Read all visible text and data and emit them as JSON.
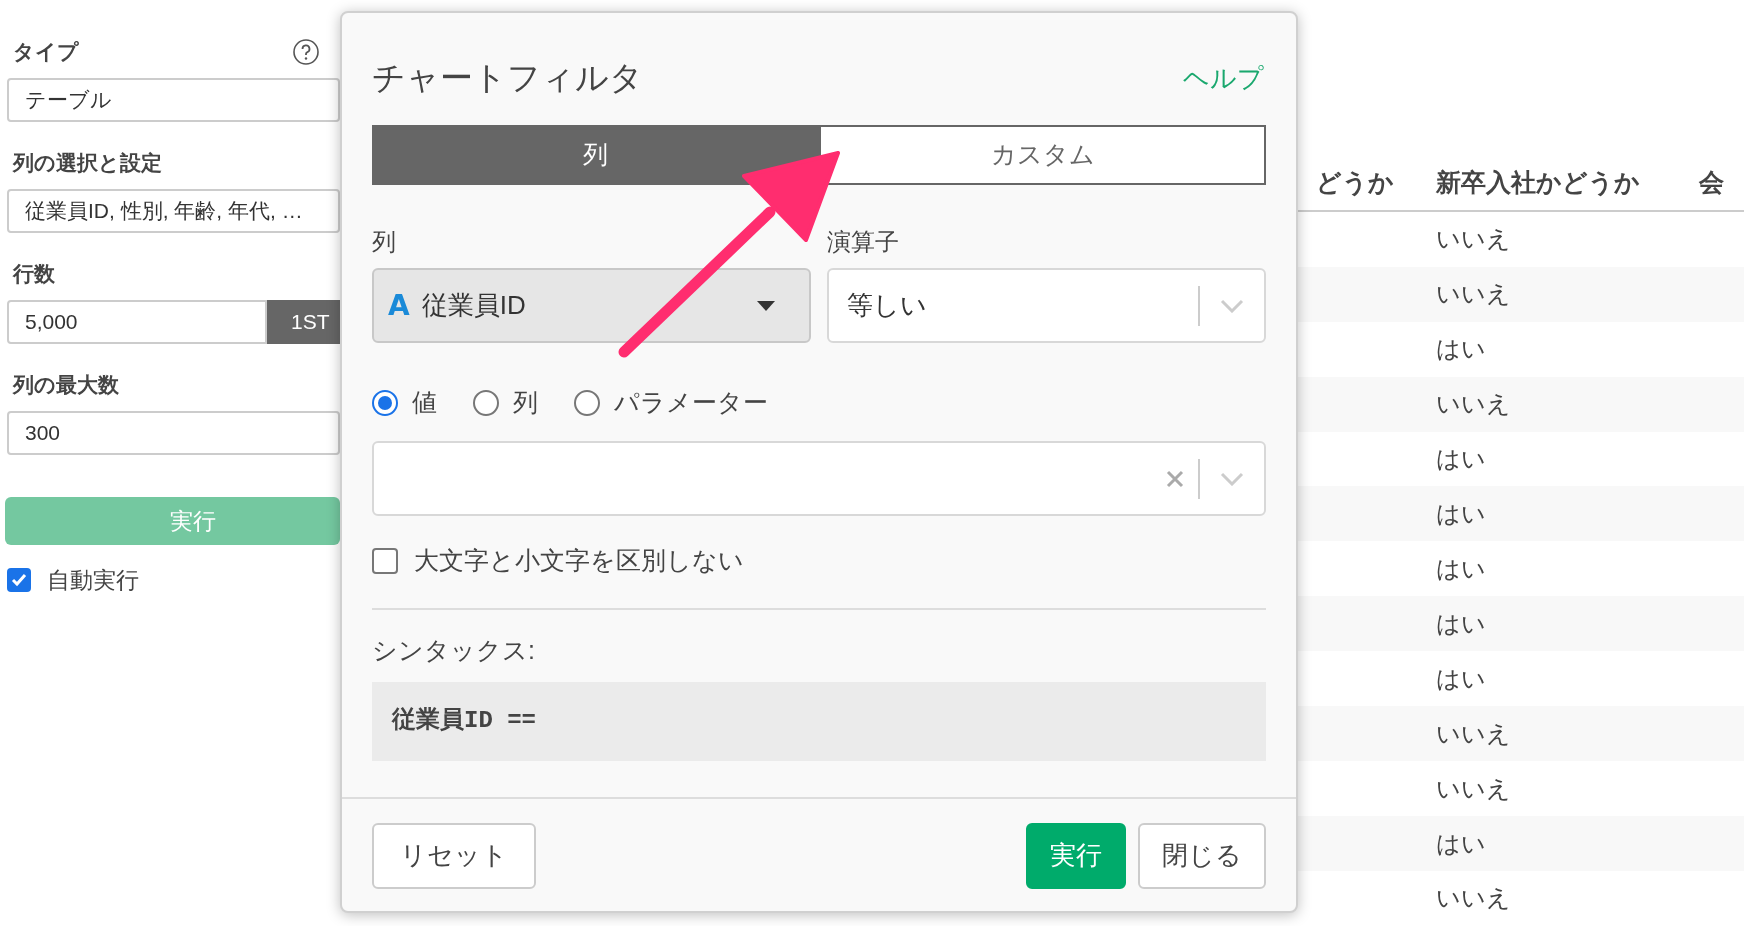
{
  "settings": {
    "type_label": "タイプ",
    "type_value": "テーブル",
    "columns_label": "列の選択と設定",
    "columns_value": "従業員ID, 性別, 年齢, 年代, …",
    "rows_label": "行数",
    "rows_value": "5,000",
    "rows_button": "1ST",
    "max_columns_label": "列の最大数",
    "max_columns_value": "300",
    "run_button": "実行",
    "auto_run": {
      "label": "自動実行",
      "checked": true
    }
  },
  "table": {
    "columns": [
      "どうか",
      "新卒入社かどうか",
      "会"
    ],
    "rows": [
      {
        "column_2": "いいえ"
      },
      {
        "column_2": "いいえ"
      },
      {
        "column_2": "はい"
      },
      {
        "column_2": "いいえ"
      },
      {
        "column_2": "はい"
      },
      {
        "column_2": "はい"
      },
      {
        "column_2": "はい"
      },
      {
        "column_2": "はい"
      },
      {
        "column_2": "はい"
      },
      {
        "column_2": "いいえ"
      },
      {
        "column_2": "いいえ"
      },
      {
        "column_2": "はい"
      },
      {
        "column_2": "いいえ"
      }
    ]
  },
  "dialog": {
    "title": "チャートフィルタ",
    "help_link": "ヘルプ",
    "tabs": [
      {
        "label": "列",
        "selected": true
      },
      {
        "label": "カスタム",
        "selected": false
      }
    ],
    "column_label": "列",
    "column_type": "A",
    "column_value": "従業員ID",
    "operator_label": "演算子",
    "operator_value": "等しい",
    "value_modes": [
      {
        "label": "値",
        "selected": true
      },
      {
        "label": "列",
        "selected": false
      },
      {
        "label": "パラメーター",
        "selected": false
      }
    ],
    "case_insensitive": {
      "label": "大文字と小文字を区別しない",
      "checked": false
    },
    "syntax_label": "シンタックス:",
    "syntax_code": "従業員ID ==",
    "buttons": [
      {
        "label": "リセット",
        "kind": "secondary"
      },
      {
        "label": "実行",
        "kind": "primary"
      },
      {
        "label": "閉じる",
        "kind": "secondary"
      }
    ]
  }
}
